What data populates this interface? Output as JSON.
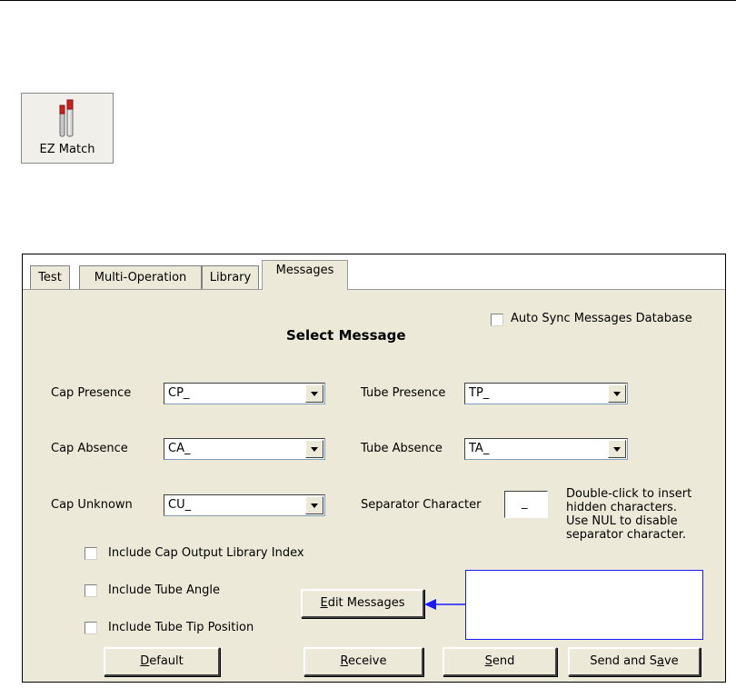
{
  "toolbar_button": {
    "label": "EZ Match",
    "icon": "test-tubes-icon"
  },
  "dialog": {
    "tabs": [
      "Test",
      "Multi-Operation",
      "Library",
      "Messages"
    ],
    "active_tab": "Messages",
    "title": "Select Message",
    "auto_sync_label": "Auto Sync Messages Database",
    "auto_sync_checked": false,
    "fields": {
      "cap_presence": {
        "label": "Cap Presence",
        "value": "CP_"
      },
      "cap_absence": {
        "label": "Cap Absence",
        "value": "CA_"
      },
      "cap_unknown": {
        "label": "Cap Unknown",
        "value": "CU_"
      },
      "tube_presence": {
        "label": "Tube Presence",
        "value": "TP_"
      },
      "tube_absence": {
        "label": "Tube Absence",
        "value": "TA_"
      }
    },
    "separator": {
      "label": "Separator Character",
      "value": "_",
      "hint_lines": [
        "Double-click to insert",
        "hidden characters.",
        "Use NUL to disable",
        "separator character."
      ]
    },
    "checkboxes": {
      "cap_output_library_index": {
        "label": "Include Cap Output Library Index",
        "checked": false
      },
      "tube_angle": {
        "label": "Include Tube Angle",
        "checked": false
      },
      "tube_tip_position": {
        "label": "Include Tube Tip Position",
        "checked": false
      }
    },
    "buttons": {
      "edit_messages": {
        "mnemonic": "E",
        "rest": "dit Messages"
      },
      "default": {
        "mnemonic": "D",
        "rest": "efault"
      },
      "receive": {
        "mnemonic": "R",
        "rest": "eceive"
      },
      "send": {
        "mnemonic": "S",
        "rest": "end"
      },
      "send_and_save": {
        "pre": "Send and S",
        "mnemonic": "a",
        "rest": "ve"
      }
    }
  },
  "colors": {
    "panel": "#ece9d8",
    "callout_border": "#1a1aff",
    "arrow": "#1a1aff"
  }
}
